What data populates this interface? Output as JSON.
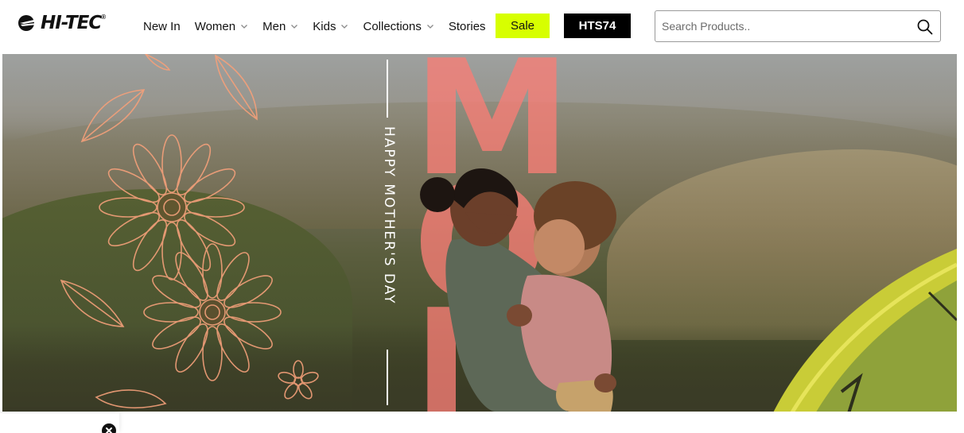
{
  "brand": {
    "name": "HI-TEC",
    "reg_mark": "®"
  },
  "nav": {
    "items": [
      {
        "label": "New In",
        "has_dropdown": false
      },
      {
        "label": "Women",
        "has_dropdown": true
      },
      {
        "label": "Men",
        "has_dropdown": true
      },
      {
        "label": "Kids",
        "has_dropdown": true
      },
      {
        "label": "Collections",
        "has_dropdown": true
      },
      {
        "label": "Stories",
        "has_dropdown": false
      }
    ],
    "sale_label": "Sale",
    "hts_label": "HTS74"
  },
  "search": {
    "placeholder": "Search Products..",
    "value": "",
    "icon": "search-icon"
  },
  "hero": {
    "vertical_text": "HAPPY MOTHER'S DAY",
    "big_letters": [
      "M",
      "O",
      "M"
    ]
  },
  "popup": {
    "close_icon": "close-icon"
  },
  "colors": {
    "sale_bg": "#d7ff00",
    "hts_bg": "#000000",
    "mom_letters": "#f87e76"
  }
}
